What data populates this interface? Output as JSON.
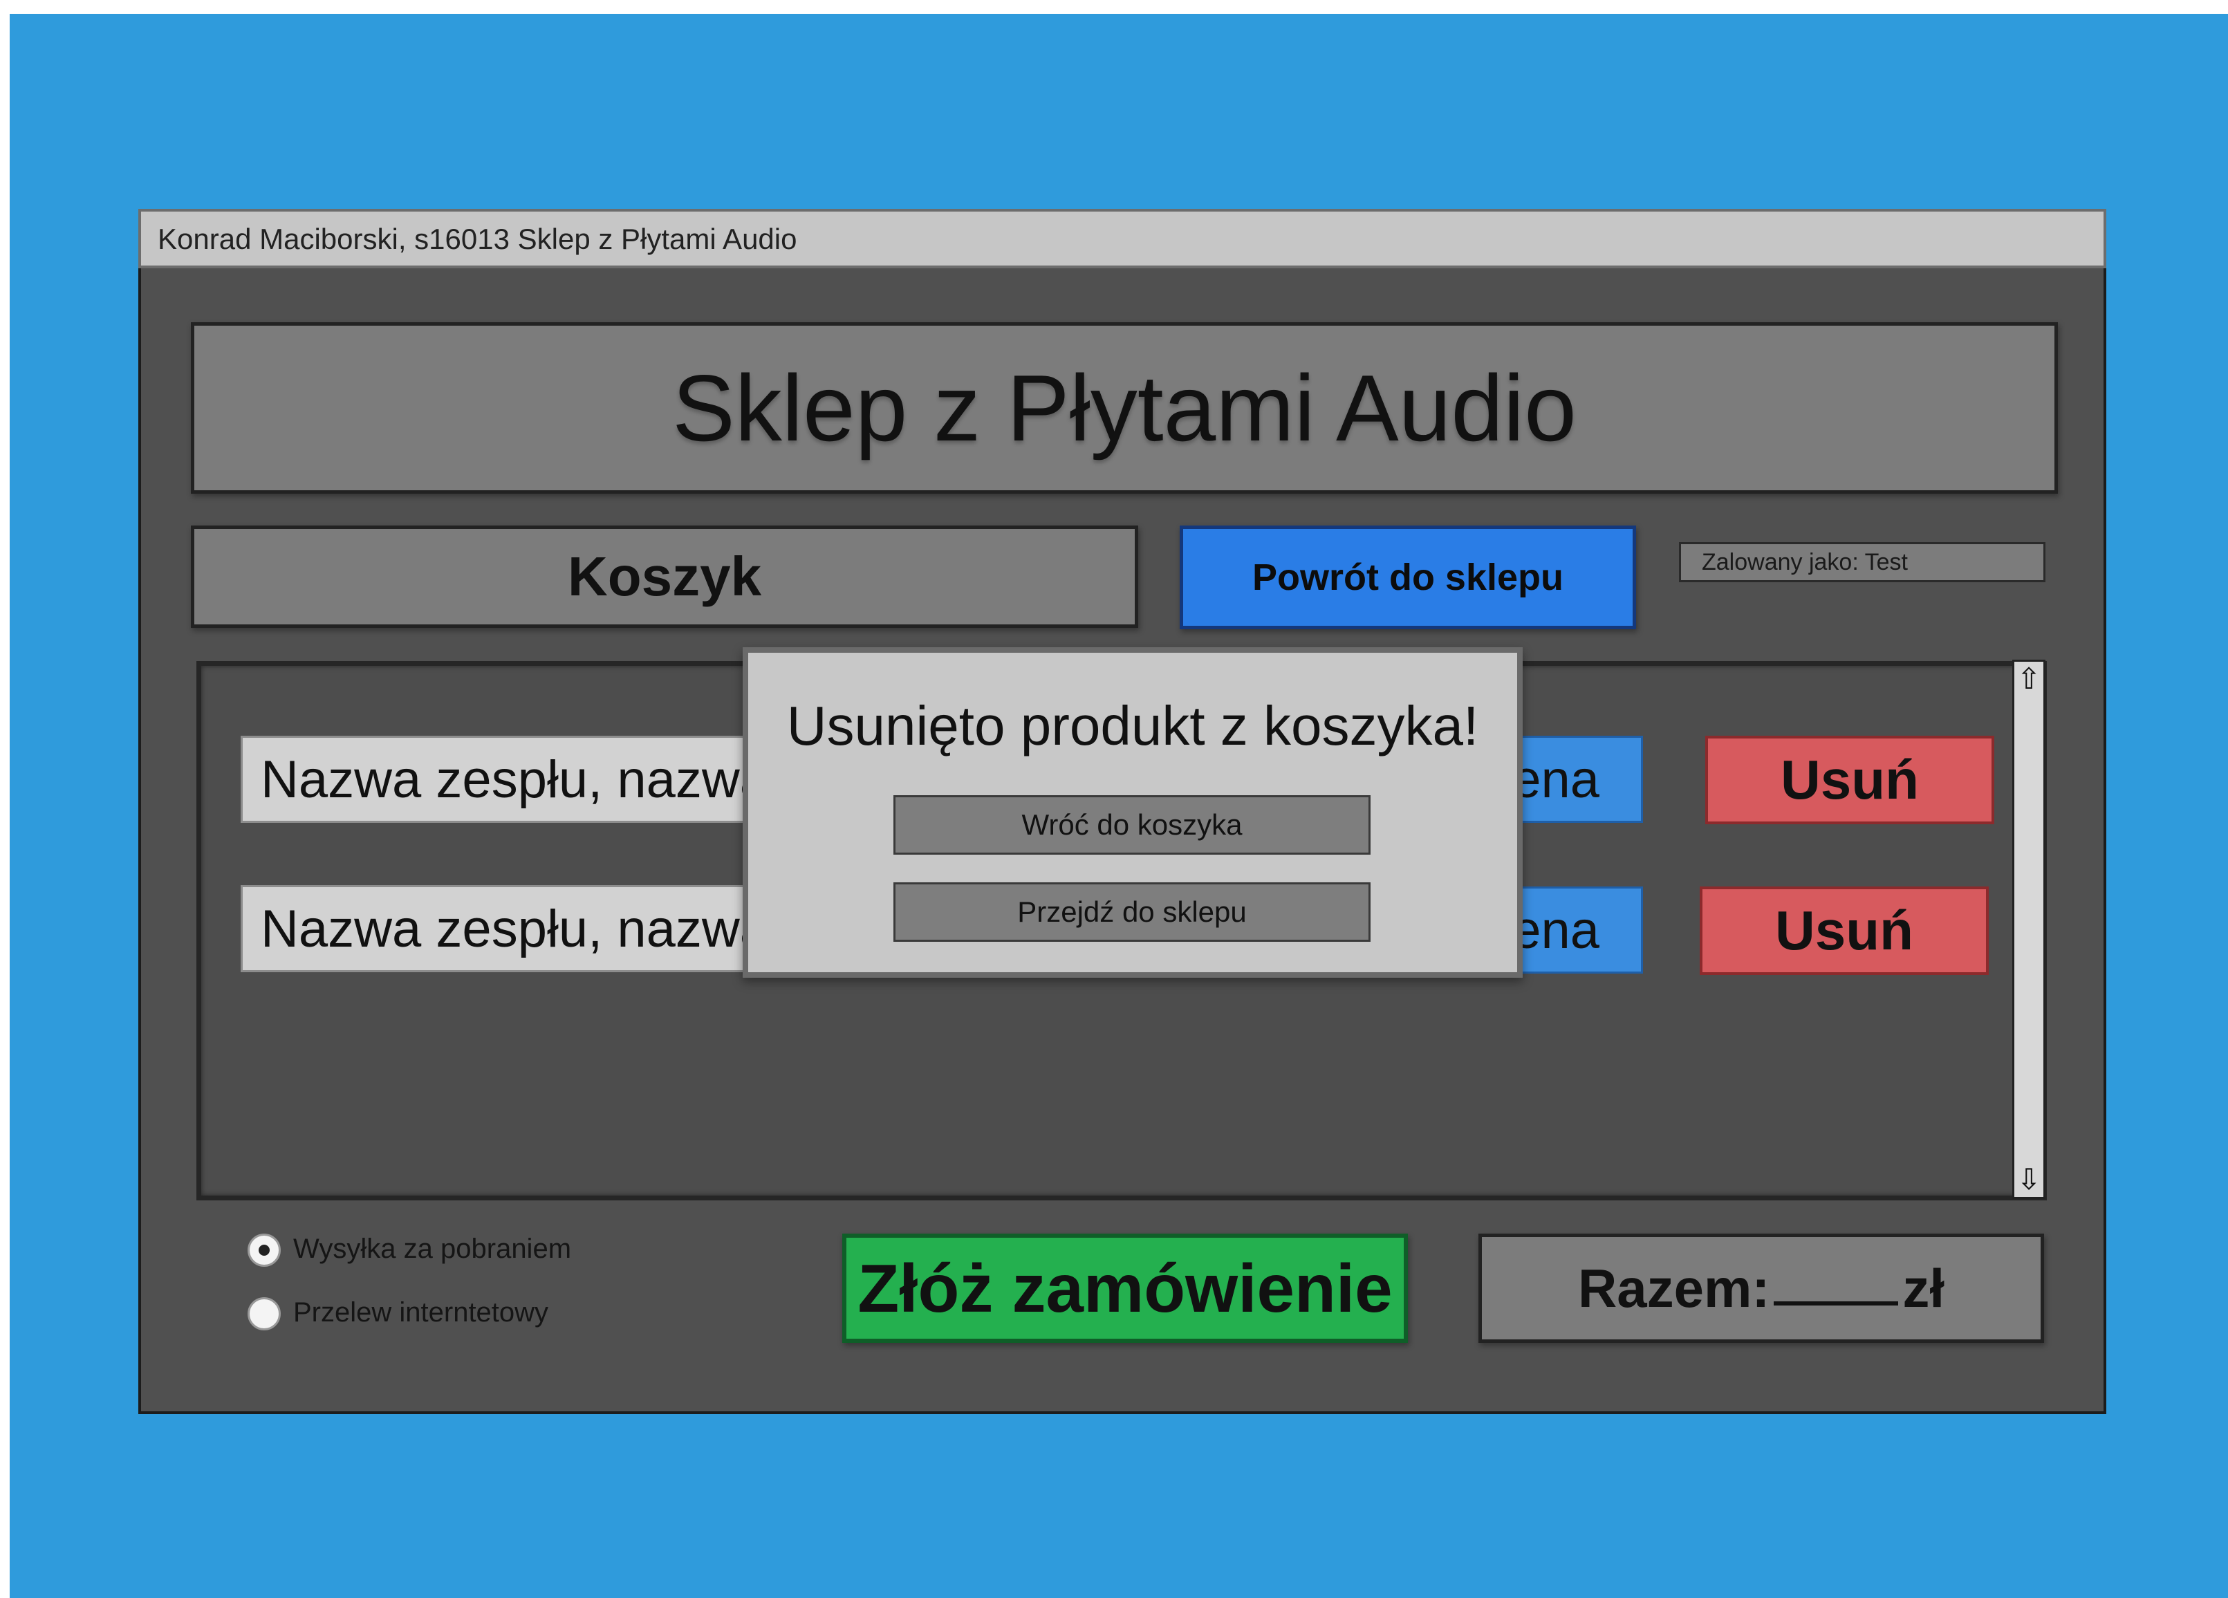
{
  "window": {
    "title": "Konrad Maciborski, s16013 Sklep z Płytami Audio"
  },
  "header": {
    "title": "Sklep z Płytami Audio"
  },
  "toolbar": {
    "cart_title": "Koszyk",
    "back_button": "Powrót do sklepu",
    "logged_in_as": "Zalowany jako: Test"
  },
  "cart": {
    "items": [
      {
        "name": "Nazwa zespłu, nazwa płyty",
        "price": "Cena",
        "remove": "Usuń"
      },
      {
        "name": "Nazwa zespłu, nazwa płyty",
        "price": "Cena",
        "remove": "Usuń"
      }
    ]
  },
  "modal": {
    "message": "Usunięto produkt z koszyka!",
    "back_to_cart": "Wróć do koszyka",
    "go_to_shop": "Przejdź do sklepu"
  },
  "payment": {
    "options": [
      {
        "label": "Wysyłka za pobraniem",
        "selected": true
      },
      {
        "label": "Przelew interntetowy",
        "selected": false
      }
    ]
  },
  "footer": {
    "order_button": "Złóż zamówienie",
    "total_label": "Razem:",
    "total_currency": "zł"
  },
  "icons": {
    "scroll_up": "arrow-up-icon",
    "scroll_down": "arrow-down-icon"
  },
  "colors": {
    "background": "#2f9bdc",
    "window": "#505050",
    "primary_button": "#2a7de6",
    "danger_button": "#d75a5e",
    "success_button": "#24b04f"
  }
}
